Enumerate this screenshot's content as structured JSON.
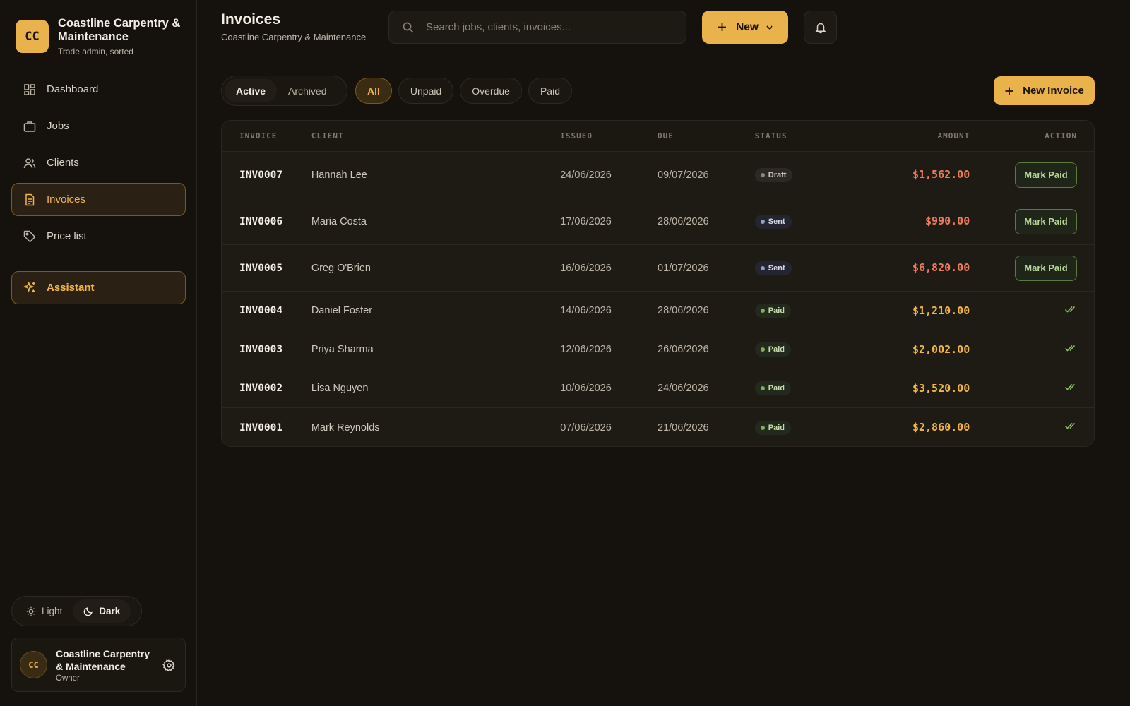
{
  "brand": {
    "initials": "CC",
    "name": "Coastline Carpentry & Maintenance",
    "tagline": "Trade admin, sorted"
  },
  "nav": [
    {
      "label": "Dashboard",
      "icon": "dashboard-icon"
    },
    {
      "label": "Jobs",
      "icon": "briefcase-icon"
    },
    {
      "label": "Clients",
      "icon": "users-icon"
    },
    {
      "label": "Invoices",
      "icon": "document-icon",
      "active": true
    },
    {
      "label": "Price list",
      "icon": "tag-icon"
    }
  ],
  "assistant": {
    "label": "Assistant",
    "icon": "sparkle-icon"
  },
  "theme": {
    "light": "Light",
    "dark": "Dark",
    "selected": "Dark"
  },
  "user": {
    "initials": "CC",
    "name": "Coastline Carpentry & Maintenance",
    "role": "Owner"
  },
  "header": {
    "title": "Invoices",
    "subtitle": "Coastline Carpentry & Maintenance"
  },
  "search": {
    "placeholder": "Search jobs, clients, invoices..."
  },
  "new_button": {
    "label": "New"
  },
  "filters": {
    "archive": [
      {
        "label": "Active",
        "selected": true
      },
      {
        "label": "Archived"
      }
    ],
    "status": [
      {
        "label": "All",
        "selected": true
      },
      {
        "label": "Unpaid"
      },
      {
        "label": "Overdue"
      },
      {
        "label": "Paid"
      }
    ]
  },
  "new_invoice": {
    "label": "New Invoice"
  },
  "table": {
    "columns": [
      "INVOICE",
      "CLIENT",
      "ISSUED",
      "DUE",
      "STATUS",
      "AMOUNT",
      "ACTION"
    ],
    "rows": [
      {
        "invoice": "INV0007",
        "client": "Hannah Lee",
        "issued": "24/06/2026",
        "due": "09/07/2026",
        "status": "Draft",
        "amount": "$1,562.00",
        "action": "Mark Paid"
      },
      {
        "invoice": "INV0006",
        "client": "Maria Costa",
        "issued": "17/06/2026",
        "due": "28/06/2026",
        "status": "Sent",
        "amount": "$990.00",
        "action": "Mark Paid"
      },
      {
        "invoice": "INV0005",
        "client": "Greg O'Brien",
        "issued": "16/06/2026",
        "due": "01/07/2026",
        "status": "Sent",
        "amount": "$6,820.00",
        "action": "Mark Paid"
      },
      {
        "invoice": "INV0004",
        "client": "Daniel Foster",
        "issued": "14/06/2026",
        "due": "28/06/2026",
        "status": "Paid",
        "amount": "$1,210.00",
        "action": ""
      },
      {
        "invoice": "INV0003",
        "client": "Priya Sharma",
        "issued": "12/06/2026",
        "due": "26/06/2026",
        "status": "Paid",
        "amount": "$2,002.00",
        "action": ""
      },
      {
        "invoice": "INV0002",
        "client": "Lisa Nguyen",
        "issued": "10/06/2026",
        "due": "24/06/2026",
        "status": "Paid",
        "amount": "$3,520.00",
        "action": ""
      },
      {
        "invoice": "INV0001",
        "client": "Mark Reynolds",
        "issued": "07/06/2026",
        "due": "21/06/2026",
        "status": "Paid",
        "amount": "$2,860.00",
        "action": ""
      }
    ]
  },
  "colors": {
    "accent": "#e9b24a",
    "unpaid_amount": "#ef7b5e",
    "paid_amount": "#f1b548",
    "background": "#15120d"
  }
}
